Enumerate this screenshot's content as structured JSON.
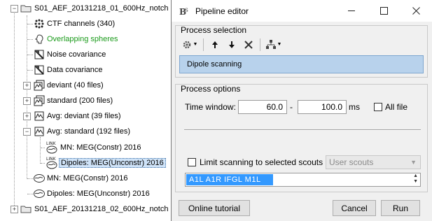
{
  "tree": {
    "items": [
      {
        "label": "S01_AEF_20131218_01_600Hz_notch",
        "icon": "folder-icon",
        "expander": "minus"
      },
      {
        "label": "CTF channels (340)",
        "icon": "channels-icon"
      },
      {
        "label": "Overlapping spheres",
        "icon": "headmodel-icon",
        "color": "#1a9a1a"
      },
      {
        "label": "Noise covariance",
        "icon": "covariance-icon"
      },
      {
        "label": "Data covariance",
        "icon": "covariance-icon"
      },
      {
        "label": "deviant (40 files)",
        "icon": "data-list-icon",
        "expander": "plus"
      },
      {
        "label": "standard (200 files)",
        "icon": "data-list-icon",
        "expander": "plus"
      },
      {
        "label": "Avg: deviant (39 files)",
        "icon": "average-icon",
        "expander": "plus"
      },
      {
        "label": "Avg: standard (192 files)",
        "icon": "average-icon",
        "expander": "minus"
      },
      {
        "label": "MN: MEG(Constr) 2016",
        "icon": "link-source-icon"
      },
      {
        "label": "Dipoles: MEG(Unconstr) 2016",
        "icon": "link-dipoles-icon",
        "selected": true
      },
      {
        "label": "MN: MEG(Constr) 2016",
        "icon": "brain-icon"
      },
      {
        "label": "Dipoles: MEG(Unconstr) 2016",
        "icon": "brain-icon"
      },
      {
        "label": "S01_AEF_20131218_02_600Hz_notch",
        "icon": "folder-icon",
        "expander": "plus"
      }
    ]
  },
  "dialog": {
    "title": "Pipeline editor",
    "logo": "brainstorm-logo-icon",
    "process_selection": {
      "title": "Process selection",
      "toolbar": [
        "gear-dropdown-icon",
        "arrow-up-icon",
        "arrow-down-icon",
        "delete-icon",
        "pipeline-dropdown-icon"
      ],
      "selected_process": "Dipole scanning"
    },
    "process_options": {
      "title": "Process options",
      "time_window_label": "Time window:",
      "time_start": "60.0",
      "time_separator": "-",
      "time_end": "100.0",
      "time_unit": "ms",
      "all_file_label": "All file",
      "all_file_checked": false,
      "limit_label": "Limit scanning to selected scouts",
      "limit_checked": false,
      "scouts_combo": "User scouts",
      "scouts_selected": "A1L   A1R   IFGL   M1L"
    },
    "buttons": {
      "online_tutorial": "Online tutorial",
      "cancel": "Cancel",
      "run": "Run"
    }
  }
}
